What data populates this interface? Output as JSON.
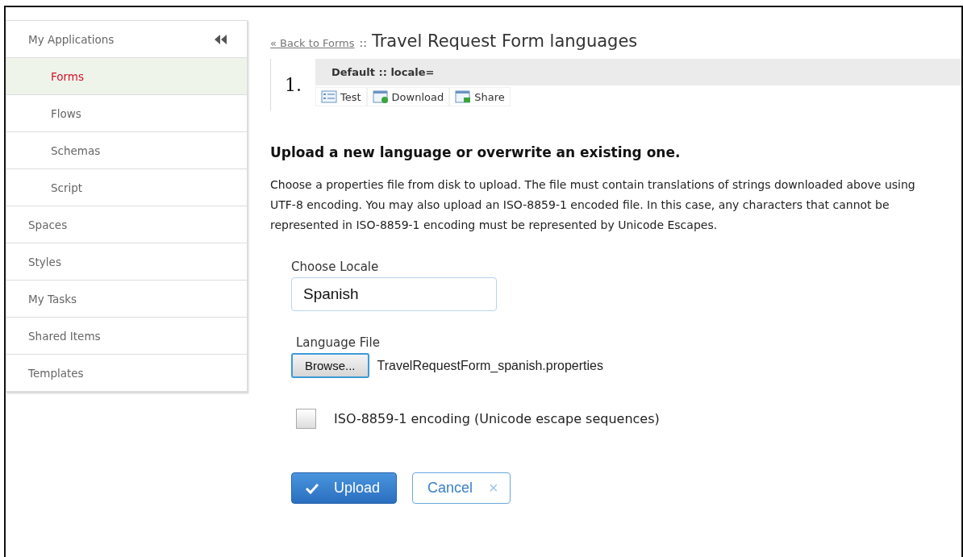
{
  "sidebar": {
    "items": [
      {
        "label": "My Applications",
        "selected": false,
        "children": [
          {
            "label": "Forms",
            "selected": true
          },
          {
            "label": "Flows",
            "selected": false
          },
          {
            "label": "Schemas",
            "selected": false
          },
          {
            "label": "Script",
            "selected": false
          }
        ]
      },
      {
        "label": "Spaces",
        "selected": false
      },
      {
        "label": "Styles",
        "selected": false
      },
      {
        "label": "My Tasks",
        "selected": false
      },
      {
        "label": "Shared Items",
        "selected": false
      },
      {
        "label": "Templates",
        "selected": false
      }
    ]
  },
  "header": {
    "back_link": "« Back to Forms",
    "separator": "::",
    "title": "Travel Request Form languages"
  },
  "languages": [
    {
      "number": "1.",
      "name": "Default :: locale=",
      "actions": [
        {
          "label": "Test",
          "kind": "test"
        },
        {
          "label": "Download",
          "kind": "download"
        },
        {
          "label": "Share",
          "kind": "share"
        }
      ]
    }
  ],
  "upload": {
    "heading": "Upload a new language or overwrite an existing one.",
    "description": "Choose a properties file from disk to upload. The file must contain translations of strings downloaded above using UTF-8 encoding. You may also upload an ISO-8859-1 encoded file. In this case, any characters that cannot be represented in ISO-8859-1 encoding must be represented by Unicode Escapes.",
    "locale_label": "Choose Locale",
    "locale_value": "Spanish",
    "file_label": "Language File",
    "browse_button": "Browse...",
    "file_name": "TravelRequestForm_spanish.properties",
    "encoding_label": "ISO-8859-1 encoding (Unicode escape sequences)",
    "encoding_checked": false,
    "upload_button": "Upload",
    "cancel_button": "Cancel",
    "cancel_icon": "×"
  }
}
